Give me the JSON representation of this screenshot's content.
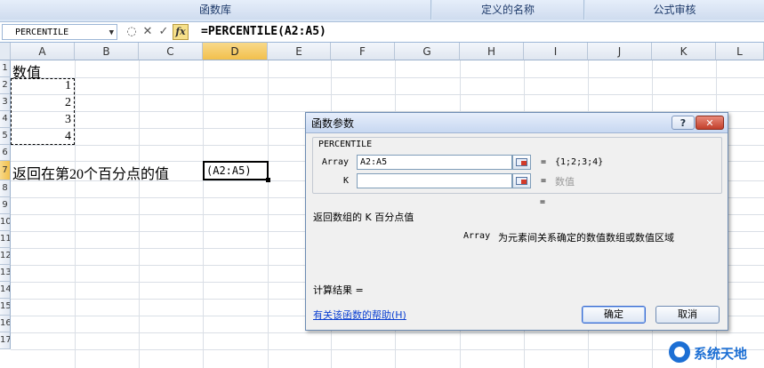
{
  "ribbon": {
    "groups": [
      {
        "label": "函数库"
      },
      {
        "label": "定义的名称"
      },
      {
        "label": "公式审核"
      }
    ]
  },
  "formula_bar": {
    "name_box": "PERCENTILE",
    "formula": "=PERCENTILE(A2:A5)",
    "fx_label": "fx"
  },
  "sheet": {
    "columns": [
      "A",
      "B",
      "C",
      "D",
      "E",
      "F",
      "G",
      "H",
      "I",
      "J",
      "K",
      "L"
    ],
    "rows": [
      "1",
      "2",
      "3",
      "4",
      "5",
      "6",
      "7",
      "8",
      "9",
      "10",
      "11",
      "12",
      "13",
      "14",
      "15",
      "16",
      "17"
    ],
    "a1": "数值",
    "values": [
      "1",
      "2",
      "3",
      "4"
    ],
    "a7": "返回在第20个百分点的值",
    "d7_edit": "(A2:A5)"
  },
  "dialog": {
    "title": "函数参数",
    "help_glyph": "?",
    "close_glyph": "✕",
    "function_name": "PERCENTILE",
    "args": [
      {
        "label": "Array",
        "value": "A2:A5",
        "equals": "=",
        "result": "{1;2;3;4}"
      },
      {
        "label": "K",
        "value": "",
        "equals": "=",
        "result": "数值"
      }
    ],
    "result_equals": "=",
    "description": "返回数组的 K 百分点值",
    "arg_help_name": "Array",
    "arg_help_text": "为元素间关系确定的数值数组或数值区域",
    "calc_result": "计算结果 =",
    "help_link": "有关该函数的帮助(H)",
    "ok_label": "确定",
    "cancel_label": "取消"
  },
  "watermark": {
    "text": "系统天地"
  },
  "colors": {
    "selected_header": "#f2c04c",
    "link": "#0a3fd1",
    "close_button": "#c2402b"
  }
}
